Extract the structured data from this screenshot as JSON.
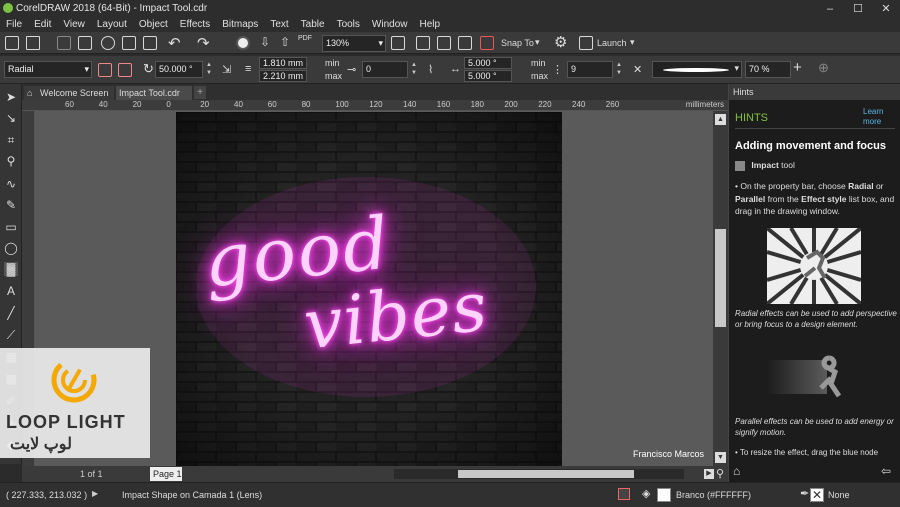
{
  "app": {
    "title": "CorelDRAW 2018 (64-Bit) - Impact Tool.cdr"
  },
  "menu": [
    "File",
    "Edit",
    "View",
    "Layout",
    "Object",
    "Effects",
    "Bitmaps",
    "Text",
    "Table",
    "Tools",
    "Window",
    "Help"
  ],
  "standard_toolbar": {
    "zoom_value": "130%",
    "snap_label": "Snap To",
    "launch_label": "Launch"
  },
  "property_bar": {
    "effect_style": "Radial",
    "angle": "50.000 °",
    "line_width_min": "1.810 mm",
    "line_width_max": "2.210 mm",
    "min_label": "min",
    "max_label": "max",
    "offset": "0",
    "spacing_min": "5.000 °",
    "spacing_max": "5.000 °",
    "count": "9",
    "opacity": "70 %"
  },
  "tabs": {
    "welcome": "Welcome Screen",
    "document": "Impact Tool.cdr"
  },
  "ruler": {
    "ticks": [
      "60",
      "40",
      "20",
      "0",
      "20",
      "40",
      "60",
      "80",
      "100",
      "120",
      "140",
      "160",
      "180",
      "200",
      "220",
      "240",
      "260"
    ],
    "unit": "millimeters"
  },
  "canvas": {
    "neon_line1": "good",
    "neon_line2": "vibes",
    "credit": "Francisco Marcos"
  },
  "page_nav": {
    "page_label": "Page 1",
    "counter": "1 of 1"
  },
  "hints": {
    "panel_title": "Hints",
    "header": "HINTS",
    "learn_more": "Learn more",
    "heading": "Adding movement and focus",
    "tool_name": "Impact",
    "tool_suffix": "tool",
    "bullet1_a": "On the property bar, choose ",
    "bullet1_b": "Radial",
    "bullet1_c": " or ",
    "bullet1_d": "Parallel",
    "bullet1_e": " from the ",
    "bullet1_f": "Effect style",
    "bullet1_g": " list box, and drag in the drawing window.",
    "caption_radial": "Radial effects can be used to add perspective or bring focus to a design element.",
    "caption_parallel": "Parallel effects can be used to add energy or signify motion.",
    "bullet2": "To resize the effect, drag the blue node"
  },
  "status": {
    "coords": "( 227.333, 213.032 )",
    "object_info": "Impact Shape on Camada 1  (Lens)",
    "fill_label": "Branco (#FFFFFF)",
    "outline_label": "None"
  },
  "watermark": {
    "brand_latin": "LOOP LIGHT",
    "brand_arabic": "لوپ لایت"
  },
  "colors": {
    "neon": "#ff3df0",
    "accent": "#7ec242",
    "ui_bg": "#3a3a3a"
  }
}
